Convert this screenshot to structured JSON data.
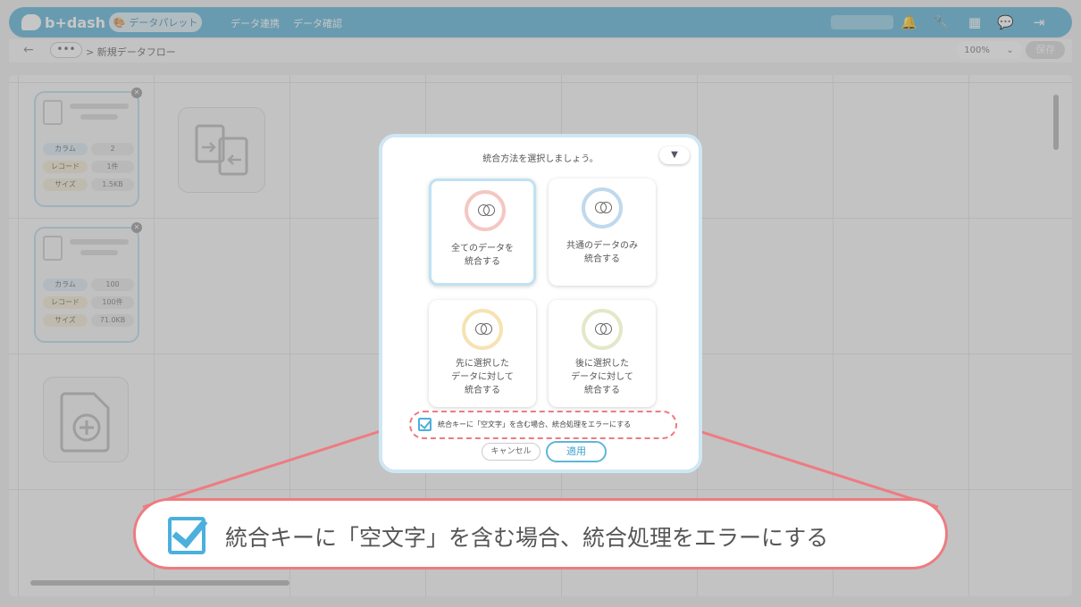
{
  "header": {
    "logo": "b+dash",
    "palette_label": "データパレット",
    "nav": [
      "データ連携",
      "データ確認"
    ]
  },
  "breadcrumb": {
    "more": "•••",
    "path": "> 新規データフロー",
    "zoom": "100%",
    "save": "保存"
  },
  "cards": [
    {
      "stats": [
        {
          "k": "カラム",
          "v": "2"
        },
        {
          "k": "レコード",
          "v": "1件"
        },
        {
          "k": "サイズ",
          "v": "1.5KB"
        }
      ]
    },
    {
      "stats": [
        {
          "k": "カラム",
          "v": "100"
        },
        {
          "k": "レコード",
          "v": "100件"
        },
        {
          "k": "サイズ",
          "v": "71.0KB"
        }
      ]
    }
  ],
  "modal": {
    "title": "統合方法を選択しましょう。",
    "options": [
      {
        "label": "全てのデータを\n統合する",
        "color": "#f4c7c3"
      },
      {
        "label": "共通のデータのみ\n統合する",
        "color": "#bfd9ee"
      },
      {
        "label": "先に選択した\nデータに対して\n統合する",
        "color": "#f6e3b2"
      },
      {
        "label": "後に選択した\nデータに対して\n統合する",
        "color": "#e3e8c8"
      }
    ],
    "checkbox_label": "統合キーに「空文字」を含む場合、統合処理をエラーにする",
    "cancel": "キャンセル",
    "apply": "適用"
  },
  "callout": {
    "text": "統合キーに「空文字」を含む場合、統合処理をエラーにする"
  },
  "colors": {
    "brand": "#5fb6d9",
    "highlight": "#ee7b82",
    "check": "#4bb0dd"
  }
}
